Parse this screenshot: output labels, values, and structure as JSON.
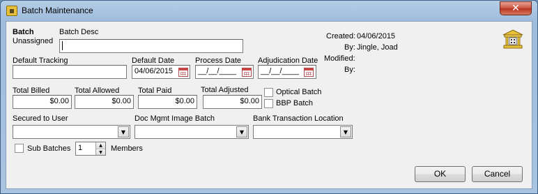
{
  "window": {
    "title": "Batch Maintenance",
    "close_glyph": "✕",
    "title_icon": "bank-icon"
  },
  "batch": {
    "label": "Batch",
    "value": "Unassigned",
    "desc_label": "Batch Desc",
    "desc_value": ""
  },
  "audit": {
    "created_label": "Created:",
    "created_date": "04/06/2015",
    "created_by_label": "By:",
    "created_by": "Jingle, Joad",
    "modified_label": "Modified:",
    "modified_by_label": "By:"
  },
  "fields": {
    "default_tracking_label": "Default Tracking",
    "default_tracking_value": "",
    "default_date_label": "Default Date",
    "default_date_value": "04/06/2015",
    "process_date_label": "Process Date",
    "process_date_value": "__/__/____",
    "adjudication_date_label": "Adjudication Date",
    "adjudication_date_value": "__/__/____"
  },
  "totals": {
    "billed_label": "Total Billed",
    "billed_value": "$0.00",
    "allowed_label": "Total Allowed",
    "allowed_value": "$0.00",
    "paid_label": "Total Paid",
    "paid_value": "$0.00",
    "adjusted_label": "Total Adjusted",
    "adjusted_value": "$0.00"
  },
  "checkboxes": {
    "optical_batch": "Optical Batch",
    "bbp_batch": "BBP Batch",
    "sub_batches": "Sub Batches"
  },
  "selects": {
    "secured_label": "Secured to User",
    "secured_value": "",
    "doc_mgmt_label": "Doc Mgmt Image Batch",
    "doc_mgmt_value": "",
    "bank_label": "Bank Transaction Location",
    "bank_value": "",
    "arrow_glyph": "▼"
  },
  "members": {
    "count": "1",
    "label": "Members",
    "up_glyph": "▲",
    "down_glyph": "▼"
  },
  "buttons": {
    "ok": "OK",
    "cancel": "Cancel"
  }
}
